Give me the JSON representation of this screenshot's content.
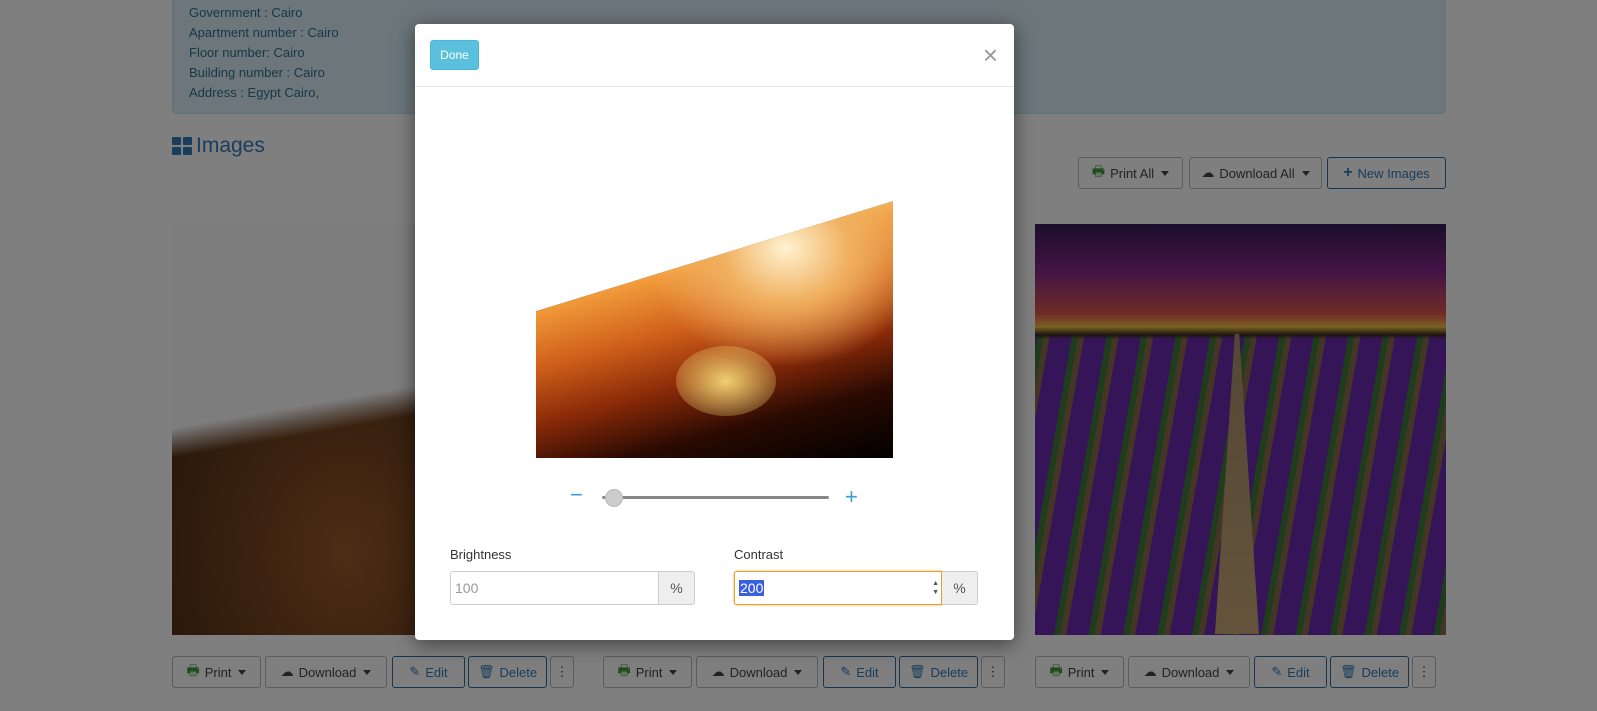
{
  "info": {
    "lines": [
      "Government : Cairo",
      "Apartment number : Cairo",
      "Floor number: Cairo",
      "Building number : Cairo",
      "Address : Egypt Cairo,"
    ]
  },
  "images_section": {
    "title": "Images",
    "print_all": "Print All",
    "download_all": "Download All",
    "new_images": "New Images"
  },
  "card_actions": {
    "print": "Print",
    "download": "Download",
    "edit": "Edit",
    "delete": "Delete"
  },
  "modal": {
    "done": "Done",
    "close": "×",
    "zoom_minus": "−",
    "zoom_plus": "+",
    "zoom_level": 0.05,
    "brightness_label": "Brightness",
    "brightness_placeholder": "100",
    "brightness_unit": "%",
    "contrast_label": "Contrast",
    "contrast_value": "200",
    "contrast_unit": "%"
  }
}
